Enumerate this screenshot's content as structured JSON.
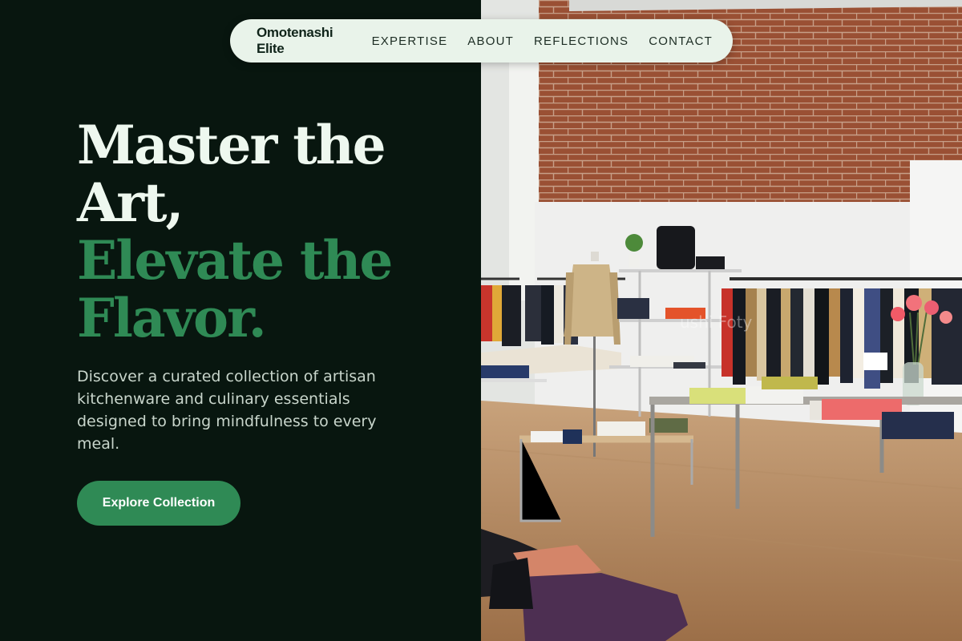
{
  "nav": {
    "brand": "Omotenashi Elite",
    "links": [
      "EXPERTISE",
      "ABOUT",
      "REFLECTIONS",
      "CONTACT"
    ]
  },
  "hero": {
    "title_lines": [
      "Master the",
      "Art,"
    ],
    "accent_lines": [
      "Elevate the",
      "Flavor."
    ],
    "description": "Discover a curated collection of artisan kitchenware and culinary essentials designed to bring mindfulness to every meal.",
    "cta": "Explore Collection"
  },
  "image": {
    "watermark": "ushi Foty"
  },
  "colors": {
    "background": "#08160f",
    "accent": "#2f8a55",
    "nav_background": "#e9f3ea",
    "heading": "#eef8ef",
    "body_text": "#c8d5cb"
  }
}
